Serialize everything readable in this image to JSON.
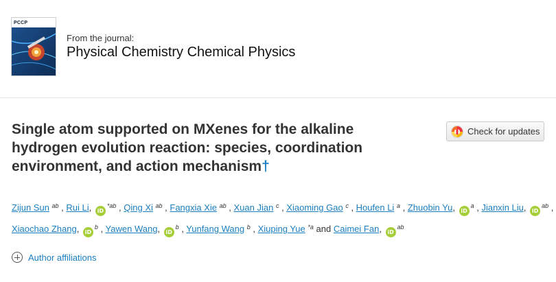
{
  "journal": {
    "cover_label": "PCCP",
    "from_label": "From the journal:",
    "title": "Physical Chemistry Chemical Physics"
  },
  "article": {
    "title_lines": [
      "Single atom supported on MXenes for the alkaline",
      "hydrogen evolution reaction: species, coordination",
      "environment, and action mechanism"
    ],
    "dagger": "†"
  },
  "check_updates": {
    "label": "Check for updates",
    "icon": "crossmark-icon"
  },
  "orcid_icon_text": "iD",
  "authors": [
    {
      "name": "Zijun Sun",
      "affil": "ab",
      "orcid": false,
      "star": false
    },
    {
      "name": "Rui Li",
      "affil": "ab",
      "orcid": true,
      "star": true
    },
    {
      "name": "Qing Xi",
      "affil": "ab",
      "orcid": false,
      "star": false
    },
    {
      "name": "Fangxia Xie",
      "affil": "ab",
      "orcid": false,
      "star": false
    },
    {
      "name": "Xuan Jian",
      "affil": "c",
      "orcid": false,
      "star": false
    },
    {
      "name": "Xiaoming Gao",
      "affil": "c",
      "orcid": false,
      "star": false
    },
    {
      "name": "Houfen Li",
      "affil": "a",
      "orcid": false,
      "star": false
    },
    {
      "name": "Zhuobin Yu",
      "affil": "a",
      "orcid": true,
      "star": false
    },
    {
      "name": "Jianxin Liu",
      "affil": "ab",
      "orcid": true,
      "star": false
    },
    {
      "name": "Xiaochao Zhang",
      "affil": "b",
      "orcid": true,
      "star": false
    },
    {
      "name": "Yawen Wang",
      "affil": "b",
      "orcid": true,
      "star": false
    },
    {
      "name": "Yunfang Wang",
      "affil": "b",
      "orcid": false,
      "star": false
    },
    {
      "name": "Xiuping Yue",
      "affil": "a",
      "orcid": false,
      "star": true
    },
    {
      "name": "Caimei Fan",
      "affil": "ab",
      "orcid": true,
      "star": false
    }
  ],
  "authors_and": "and",
  "affiliations": {
    "label": "Author affiliations",
    "icon": "plus-circle-icon"
  }
}
